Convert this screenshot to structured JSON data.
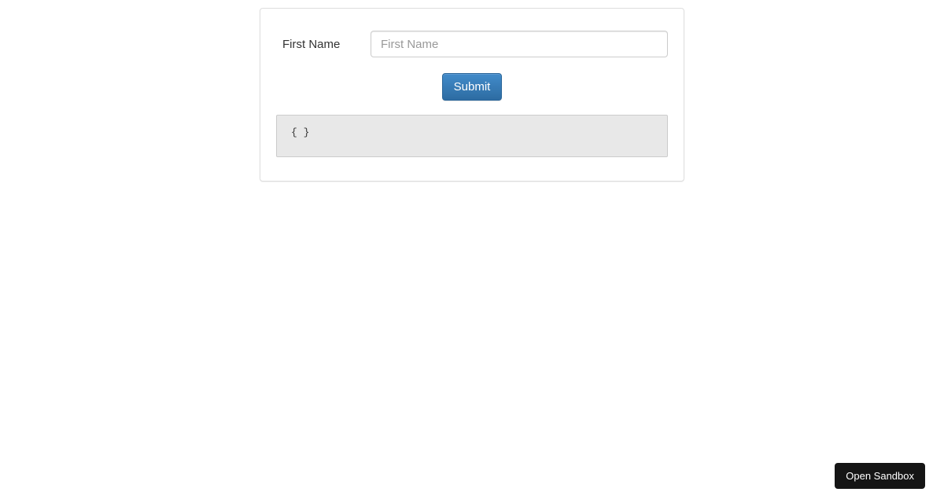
{
  "form": {
    "firstName": {
      "label": "First Name",
      "placeholder": "First Name",
      "value": ""
    },
    "submit_label": "Submit"
  },
  "output": "{ }",
  "sandbox_button": "Open Sandbox"
}
